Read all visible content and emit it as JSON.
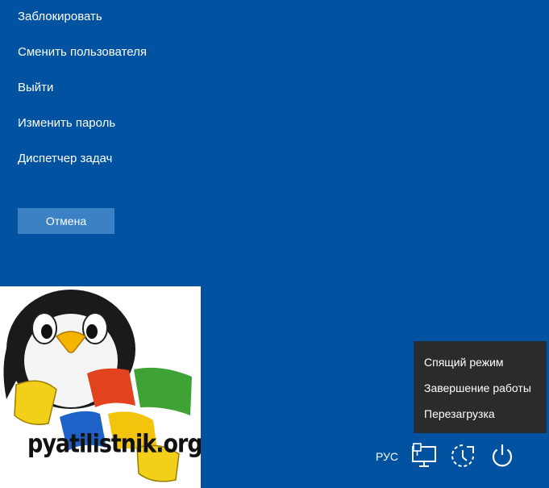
{
  "menu": {
    "lock": "Заблокировать",
    "switch_user": "Сменить пользователя",
    "sign_out": "Выйти",
    "change_password": "Изменить пароль",
    "task_manager": "Диспетчер задач"
  },
  "cancel_label": "Отмена",
  "logo": {
    "text": "pyatilistnik.org"
  },
  "power_menu": {
    "items": [
      {
        "label": "Спящий режим"
      },
      {
        "label": "Завершение работы"
      },
      {
        "label": "Перезагрузка"
      }
    ]
  },
  "tray": {
    "language": "РУС",
    "icons": [
      "network-icon",
      "accessibility-icon",
      "power-icon"
    ]
  },
  "colors": {
    "background": "#0153a1",
    "cancel_button": "#3b81c4",
    "power_menu_bg": "#2b2b2b"
  }
}
